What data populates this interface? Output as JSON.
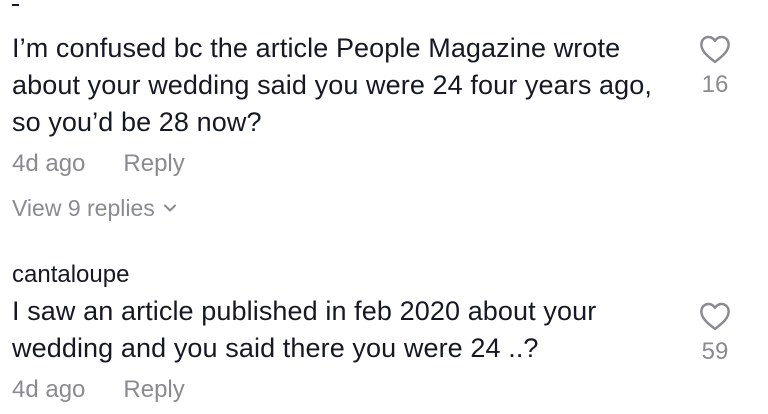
{
  "comments": [
    {
      "username": "",
      "text": "I’m confused bc the article People Magazine wrote about your wedding said you were 24 four years ago, so you’d be 28 now?",
      "time": "4d ago",
      "reply_label": "Reply",
      "view_replies": "View 9 replies",
      "likes": "16"
    },
    {
      "username": "cantaloupe",
      "text": "I saw an article published in feb 2020 about your wedding and you said there you were 24 ..?",
      "time": "4d ago",
      "reply_label": "Reply",
      "likes": "59"
    }
  ],
  "icons": {
    "like": "heart-icon",
    "expand": "chevron-down-icon"
  },
  "colors": {
    "text": "#161823",
    "secondary": "#8a8b91"
  }
}
